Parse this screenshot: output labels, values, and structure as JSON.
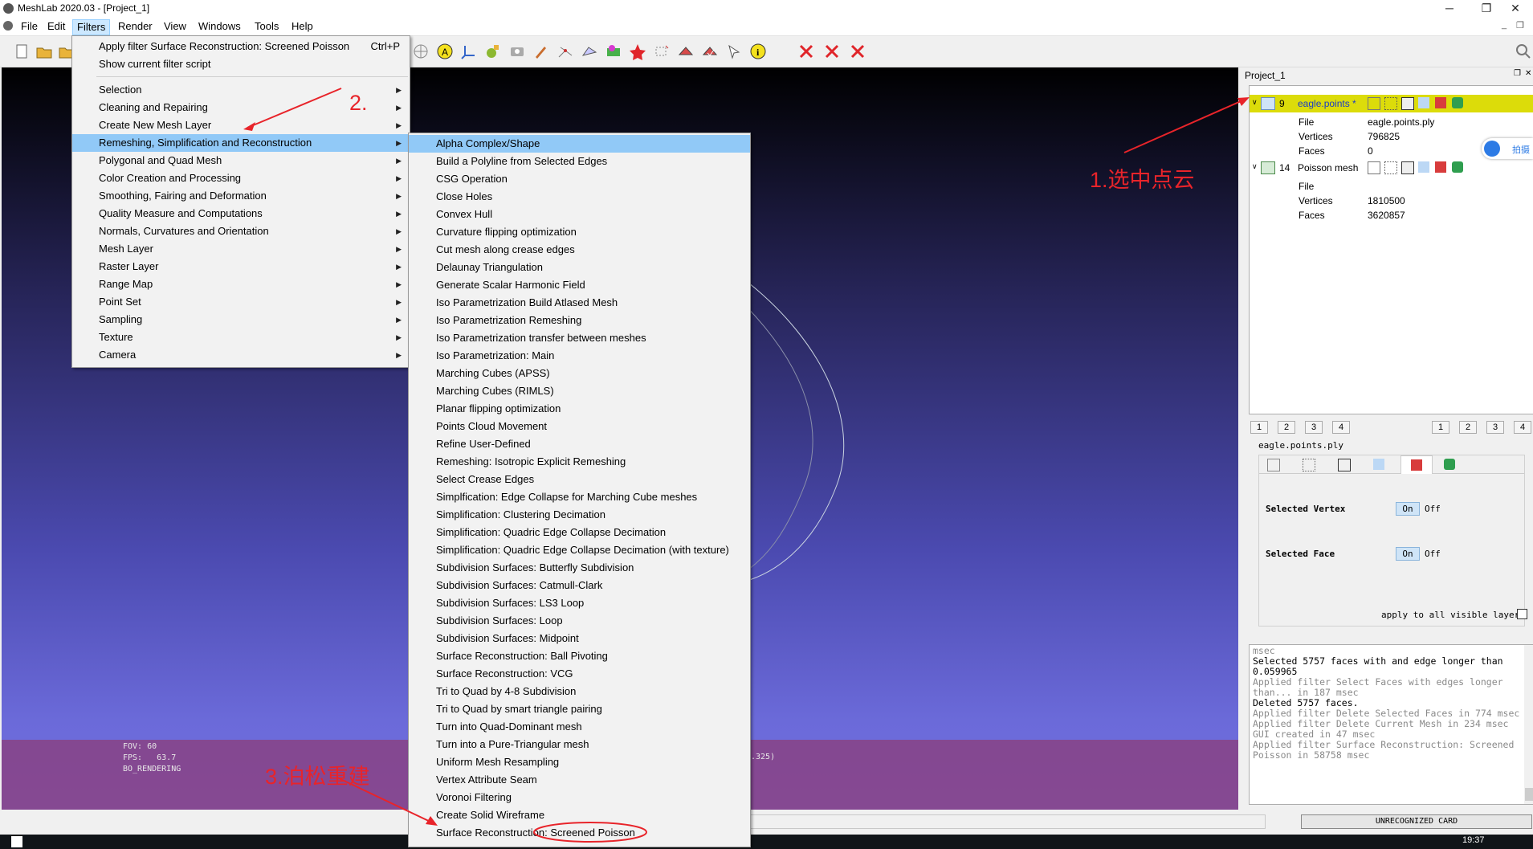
{
  "window": {
    "title": "MeshLab 2020.03 - [Project_1]",
    "minimize": "─",
    "restore": "❐",
    "close": "✕"
  },
  "menubar": {
    "items": [
      "File",
      "Edit",
      "Filters",
      "Render",
      "View",
      "Windows",
      "Tools",
      "Help"
    ],
    "active": "Filters"
  },
  "filters_menu": {
    "apply_last": "Apply filter Surface Reconstruction: Screened Poisson",
    "apply_last_shortcut": "Ctrl+P",
    "show_script": "Show current filter script",
    "categories": [
      "Selection",
      "Cleaning and Repairing",
      "Create New Mesh Layer",
      "Remeshing, Simplification and Reconstruction",
      "Polygonal and Quad Mesh",
      "Color Creation and Processing",
      "Smoothing, Fairing and Deformation",
      "Quality Measure and Computations",
      "Normals, Curvatures and Orientation",
      "Mesh Layer",
      "Raster Layer",
      "Range Map",
      "Point Set",
      "Sampling",
      "Texture",
      "Camera"
    ],
    "highlighted_category": "Remeshing, Simplification and Reconstruction"
  },
  "submenu": {
    "items": [
      "Alpha Complex/Shape",
      "Build a Polyline from Selected Edges",
      "CSG Operation",
      "Close Holes",
      "Convex Hull",
      "Curvature flipping optimization",
      "Cut mesh along crease edges",
      "Delaunay Triangulation",
      "Generate Scalar Harmonic Field",
      "Iso Parametrization Build Atlased Mesh",
      "Iso Parametrization Remeshing",
      "Iso Parametrization transfer between meshes",
      "Iso Parametrization: Main",
      "Marching Cubes (APSS)",
      "Marching Cubes (RIMLS)",
      "Planar flipping optimization",
      "Points Cloud Movement",
      "Refine User-Defined",
      "Remeshing: Isotropic Explicit Remeshing",
      "Select Crease Edges",
      "Simplfication: Edge Collapse for Marching Cube meshes",
      "Simplification: Clustering Decimation",
      "Simplification: Quadric Edge Collapse Decimation",
      "Simplification: Quadric Edge Collapse Decimation (with texture)",
      "Subdivision Surfaces: Butterfly Subdivision",
      "Subdivision Surfaces: Catmull-Clark",
      "Subdivision Surfaces: LS3 Loop",
      "Subdivision Surfaces: Loop",
      "Subdivision Surfaces: Midpoint",
      "Surface Reconstruction: Ball Pivoting",
      "Surface Reconstruction: VCG",
      "Tri to Quad by 4-8 Subdivision",
      "Tri to Quad by smart triangle pairing",
      "Turn into Quad-Dominant mesh",
      "Turn into a Pure-Triangular mesh",
      "Uniform Mesh Resampling",
      "Vertex Attribute Seam",
      "Voronoi Filtering",
      "Create Solid Wireframe",
      "Surface Reconstruction: Screened Poisson"
    ],
    "highlighted": "Alpha Complex/Shape",
    "circled": "Surface Reconstruction: Screened Poisson"
  },
  "annotations": {
    "step1": "1.选中点云",
    "step2": "2.",
    "step3": "3.泊松重建",
    "color": "#e8242a"
  },
  "viewport_info": {
    "fov": "FOV: 60",
    "fps": "FPS:   63.7",
    "mode": "BO_RENDERING",
    "coord_fragment": ".325)"
  },
  "project": {
    "title": "Project_1",
    "layers": [
      {
        "id": "9",
        "name": "eagle.points *",
        "file_label": "File",
        "file": "eagle.points.ply",
        "vertices_label": "Vertices",
        "vertices": "796825",
        "faces_label": "Faces",
        "faces": "0",
        "selected": true
      },
      {
        "id": "14",
        "name": "Poisson mesh",
        "file_label": "File",
        "file": "",
        "vertices_label": "Vertices",
        "vertices": "1810500",
        "faces_label": "Faces",
        "faces": "3620857",
        "selected": false
      }
    ],
    "tabs_left": [
      "1",
      "2",
      "3",
      "4"
    ],
    "tabs_right": [
      "1",
      "2",
      "3",
      "4"
    ]
  },
  "render_panel": {
    "mesh_name": "eagle.points.ply",
    "selected_vertex_label": "Selected Vertex",
    "selected_face_label": "Selected Face",
    "on": "On",
    "off": "Off",
    "apply_all": "apply to all visible layers"
  },
  "side_button": "拍摄",
  "log": [
    {
      "text": "msec",
      "dim": true
    },
    {
      "text": "Selected 5757 faces with and edge longer than 0.059965",
      "dim": false
    },
    {
      "text": "Applied filter Select Faces with edges longer than... in 187 msec",
      "dim": true
    },
    {
      "text": "Deleted 5757 faces.",
      "dim": false
    },
    {
      "text": "Applied filter Delete Selected Faces in 774 msec",
      "dim": true
    },
    {
      "text": "Applied filter Delete Current Mesh in 234 msec",
      "dim": true
    },
    {
      "text": "GUI created in 47 msec",
      "dim": true
    },
    {
      "text": "Applied filter Surface Reconstruction: Screened Poisson in 58758 msec",
      "dim": true
    }
  ],
  "status": {
    "card": "UNRECOGNIZED CARD",
    "clock": "19:37"
  }
}
